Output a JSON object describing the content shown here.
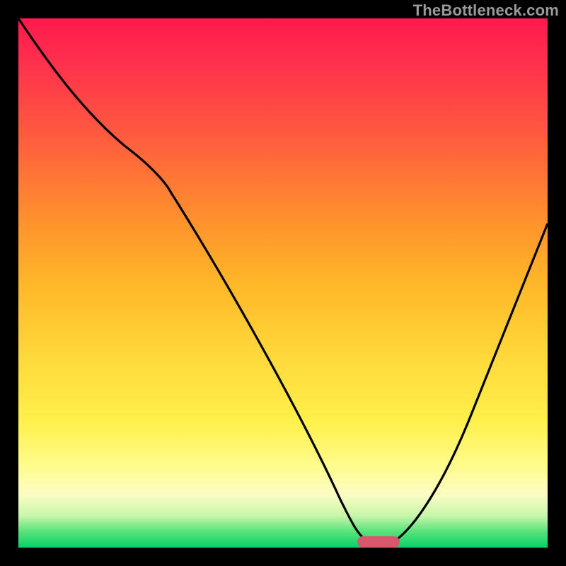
{
  "watermark": "TheBottleneck.com",
  "chart_data": {
    "type": "line",
    "title": "",
    "xlabel": "",
    "ylabel": "",
    "xlim": [
      0,
      100
    ],
    "ylim": [
      0,
      100
    ],
    "grid": false,
    "series": [
      {
        "name": "bottleneck-curve",
        "x": [
          0,
          10,
          20,
          28,
          40,
          52,
          60,
          64,
          67,
          70,
          74,
          80,
          88,
          96,
          100
        ],
        "y": [
          100,
          88,
          76,
          68,
          48,
          28,
          12,
          4,
          1,
          1,
          4,
          16,
          36,
          56,
          64
        ]
      }
    ],
    "optimum_marker": {
      "x_start": 64,
      "x_end": 72,
      "y": 0
    },
    "background_gradient": {
      "top": "#ff1a4d",
      "middle": "#ffd93a",
      "bottom": "#06d26a"
    }
  }
}
